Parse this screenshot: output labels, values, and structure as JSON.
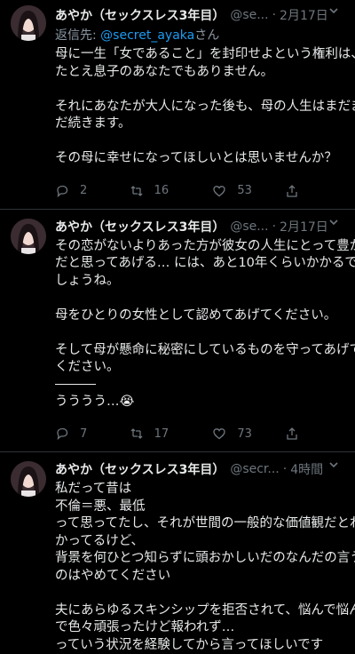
{
  "tweets": [
    {
      "name": "あやか（セックスレス3年目）",
      "handle": "@se...",
      "time": "2月17日",
      "reply_prefix": "返信先: ",
      "reply_to": "@secret_ayaka",
      "reply_suffix": "さん",
      "lines": [
        "母に一生「女であること」を封印せよという権利は、",
        "たとえ息子のあなたでもありません。",
        "",
        "それにあなたが大人になった後も、母の人生はまだま",
        "だ続きます。",
        "",
        "その母に幸せになってほしいとは思いませんか？"
      ],
      "replies": "2",
      "retweets": "16",
      "likes": "53"
    },
    {
      "name": "あやか（セックスレス3年目）",
      "handle": "@se...",
      "time": "2月17日",
      "lines_a": [
        "その恋がないよりあった方が彼女の人生にとって豊か",
        "だと思ってあげる… には、あと10年くらいかかるで",
        "しょうね。",
        "",
        "母をひとりの女性として認めてあげてください。",
        "",
        "そして母が懸命に秘密にしているものを守ってあげて",
        "ください。"
      ],
      "lines_b": [
        "うううう…😭"
      ],
      "replies": "7",
      "retweets": "17",
      "likes": "73"
    },
    {
      "name": "あやか（セックスレス3年目）",
      "handle": "@secr...",
      "time": "4時間",
      "lines": [
        "私だって昔は",
        "不倫＝悪、最低",
        "って思ってたし、それが世間の一般的な価値観だとわ",
        "かってるけど、",
        "背景を何ひとつ知らずに頭おかしいだのなんだの言う",
        "のはやめてください",
        "",
        "夫にあらゆるスキンシップを拒否されて、悩んで悩ん",
        "で色々頑張ったけど報われず…",
        "っていう状況を経験してから言ってほしいです"
      ]
    }
  ],
  "colors": {
    "bg": "#000000",
    "text": "#e7e9ea",
    "muted": "#6e767d",
    "link": "#1d9bf0",
    "divider": "#2f3336"
  },
  "icons": [
    "reply-icon",
    "retweet-icon",
    "like-icon",
    "share-icon",
    "chevron-down-icon",
    "avatar"
  ]
}
